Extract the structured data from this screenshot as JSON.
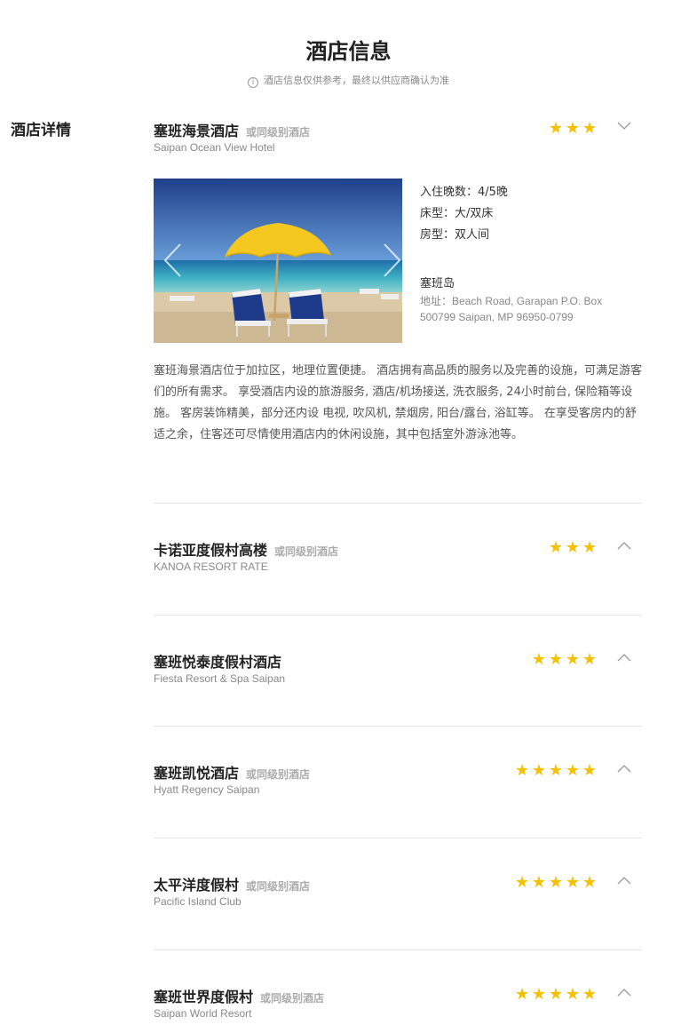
{
  "page": {
    "title": "酒店信息",
    "notice": "酒店信息仅供参考，最终以供应商确认为准",
    "section_label": "酒店详情"
  },
  "hotels": [
    {
      "name": "塞班海景酒店",
      "alt_tag": "或同级别酒店",
      "en_name": "Saipan Ocean View Hotel",
      "stars": 3,
      "expanded": true,
      "nights": "入住晚数：4/5晚",
      "bed": "床型：大/双床",
      "room": "房型：双人间",
      "island": "塞班岛",
      "address": "地址：Beach Road, Garapan P.O. Box 500799 Saipan, MP 96950-0799",
      "description": "塞班海景酒店位于加拉区，地理位置便捷。 酒店拥有高品质的服务以及完善的设施，可满足游客们的所有需求。 享受酒店内设的旅游服务, 酒店/机场接送, 洗衣服务, 24小时前台, 保险箱等设施。 客房装饰精美，部分还内设 电视, 吹风机, 禁烟房, 阳台/露台, 浴缸等。 在享受客房内的舒适之余，住客还可尽情使用酒店内的休闲设施，其中包括室外游泳池等。"
    },
    {
      "name": "卡诺亚度假村高楼",
      "alt_tag": "或同级别酒店",
      "en_name": "KANOA RESORT RATE",
      "stars": 3,
      "expanded": false
    },
    {
      "name": "塞班悦泰度假村酒店",
      "alt_tag": "",
      "en_name": "Fiesta Resort & Spa Saipan",
      "stars": 4,
      "expanded": false
    },
    {
      "name": "塞班凯悦酒店",
      "alt_tag": "或同级别酒店",
      "en_name": "Hyatt Regency Saipan",
      "stars": 5,
      "expanded": false
    },
    {
      "name": "太平洋度假村",
      "alt_tag": "或同级别酒店",
      "en_name": "Pacific Island Club",
      "stars": 5,
      "expanded": false
    },
    {
      "name": "塞班世界度假村",
      "alt_tag": "或同级别酒店",
      "en_name": "Saipan World Resort",
      "stars": 5,
      "expanded": false
    }
  ],
  "colors": {
    "star": "#f5c000",
    "divider": "#e6e6e6",
    "muted_text": "#888888"
  },
  "icons": {
    "star": "star-icon",
    "collapse": "chevron-up-icon",
    "expand": "chevron-down-icon",
    "info": "info-icon",
    "carousel_prev": "chevron-left-icon",
    "carousel_next": "chevron-right-icon"
  }
}
